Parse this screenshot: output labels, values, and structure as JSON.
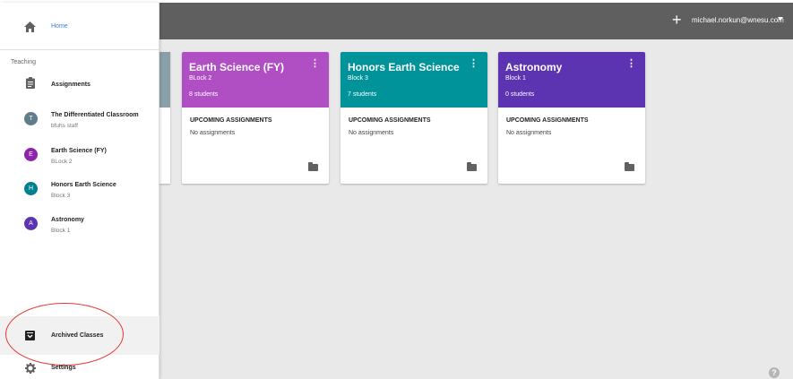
{
  "account": {
    "email": "michael.norkun@wnesu.com"
  },
  "sidebar": {
    "home_label": "Home",
    "section_label": "Teaching",
    "assignments_label": "Assignments",
    "classes": [
      {
        "initial": "T",
        "name": "The Differentiated Classroom",
        "section": "bfuhs staff",
        "color": "#607d8b"
      },
      {
        "initial": "E",
        "name": "Earth Science (FY)",
        "section": "BLock 2",
        "color": "#8e24aa"
      },
      {
        "initial": "H",
        "name": "Honors Earth Science",
        "section": "Block 3",
        "color": "#00838f"
      },
      {
        "initial": "A",
        "name": "Astronomy",
        "section": "Block 1",
        "color": "#5e35b1"
      }
    ],
    "archived_label": "Archived Classes",
    "settings_label": "Settings"
  },
  "cards": [
    {
      "title": "Earth Science (FY)",
      "section": "BLock 2",
      "students": "8 students",
      "upcoming_label": "UPCOMING ASSIGNMENTS",
      "upcoming_value": "No assignments",
      "color": "#b04fc4"
    },
    {
      "title": "Honors Earth Science",
      "section": "Block 3",
      "students": "7 students",
      "upcoming_label": "UPCOMING ASSIGNMENTS",
      "upcoming_value": "No assignments",
      "color": "#00939a"
    },
    {
      "title": "Astronomy",
      "section": "Block 1",
      "students": "0 students",
      "upcoming_label": "UPCOMING ASSIGNMENTS",
      "upcoming_value": "No assignments",
      "color": "#5c33b0"
    }
  ],
  "icons": {
    "home": "home-icon",
    "assignments": "assignment-icon",
    "archived": "archive-icon",
    "settings": "gear-icon",
    "add": "plus-icon",
    "help": "help-icon",
    "folder": "folder-icon",
    "more": "more-vert-icon"
  }
}
